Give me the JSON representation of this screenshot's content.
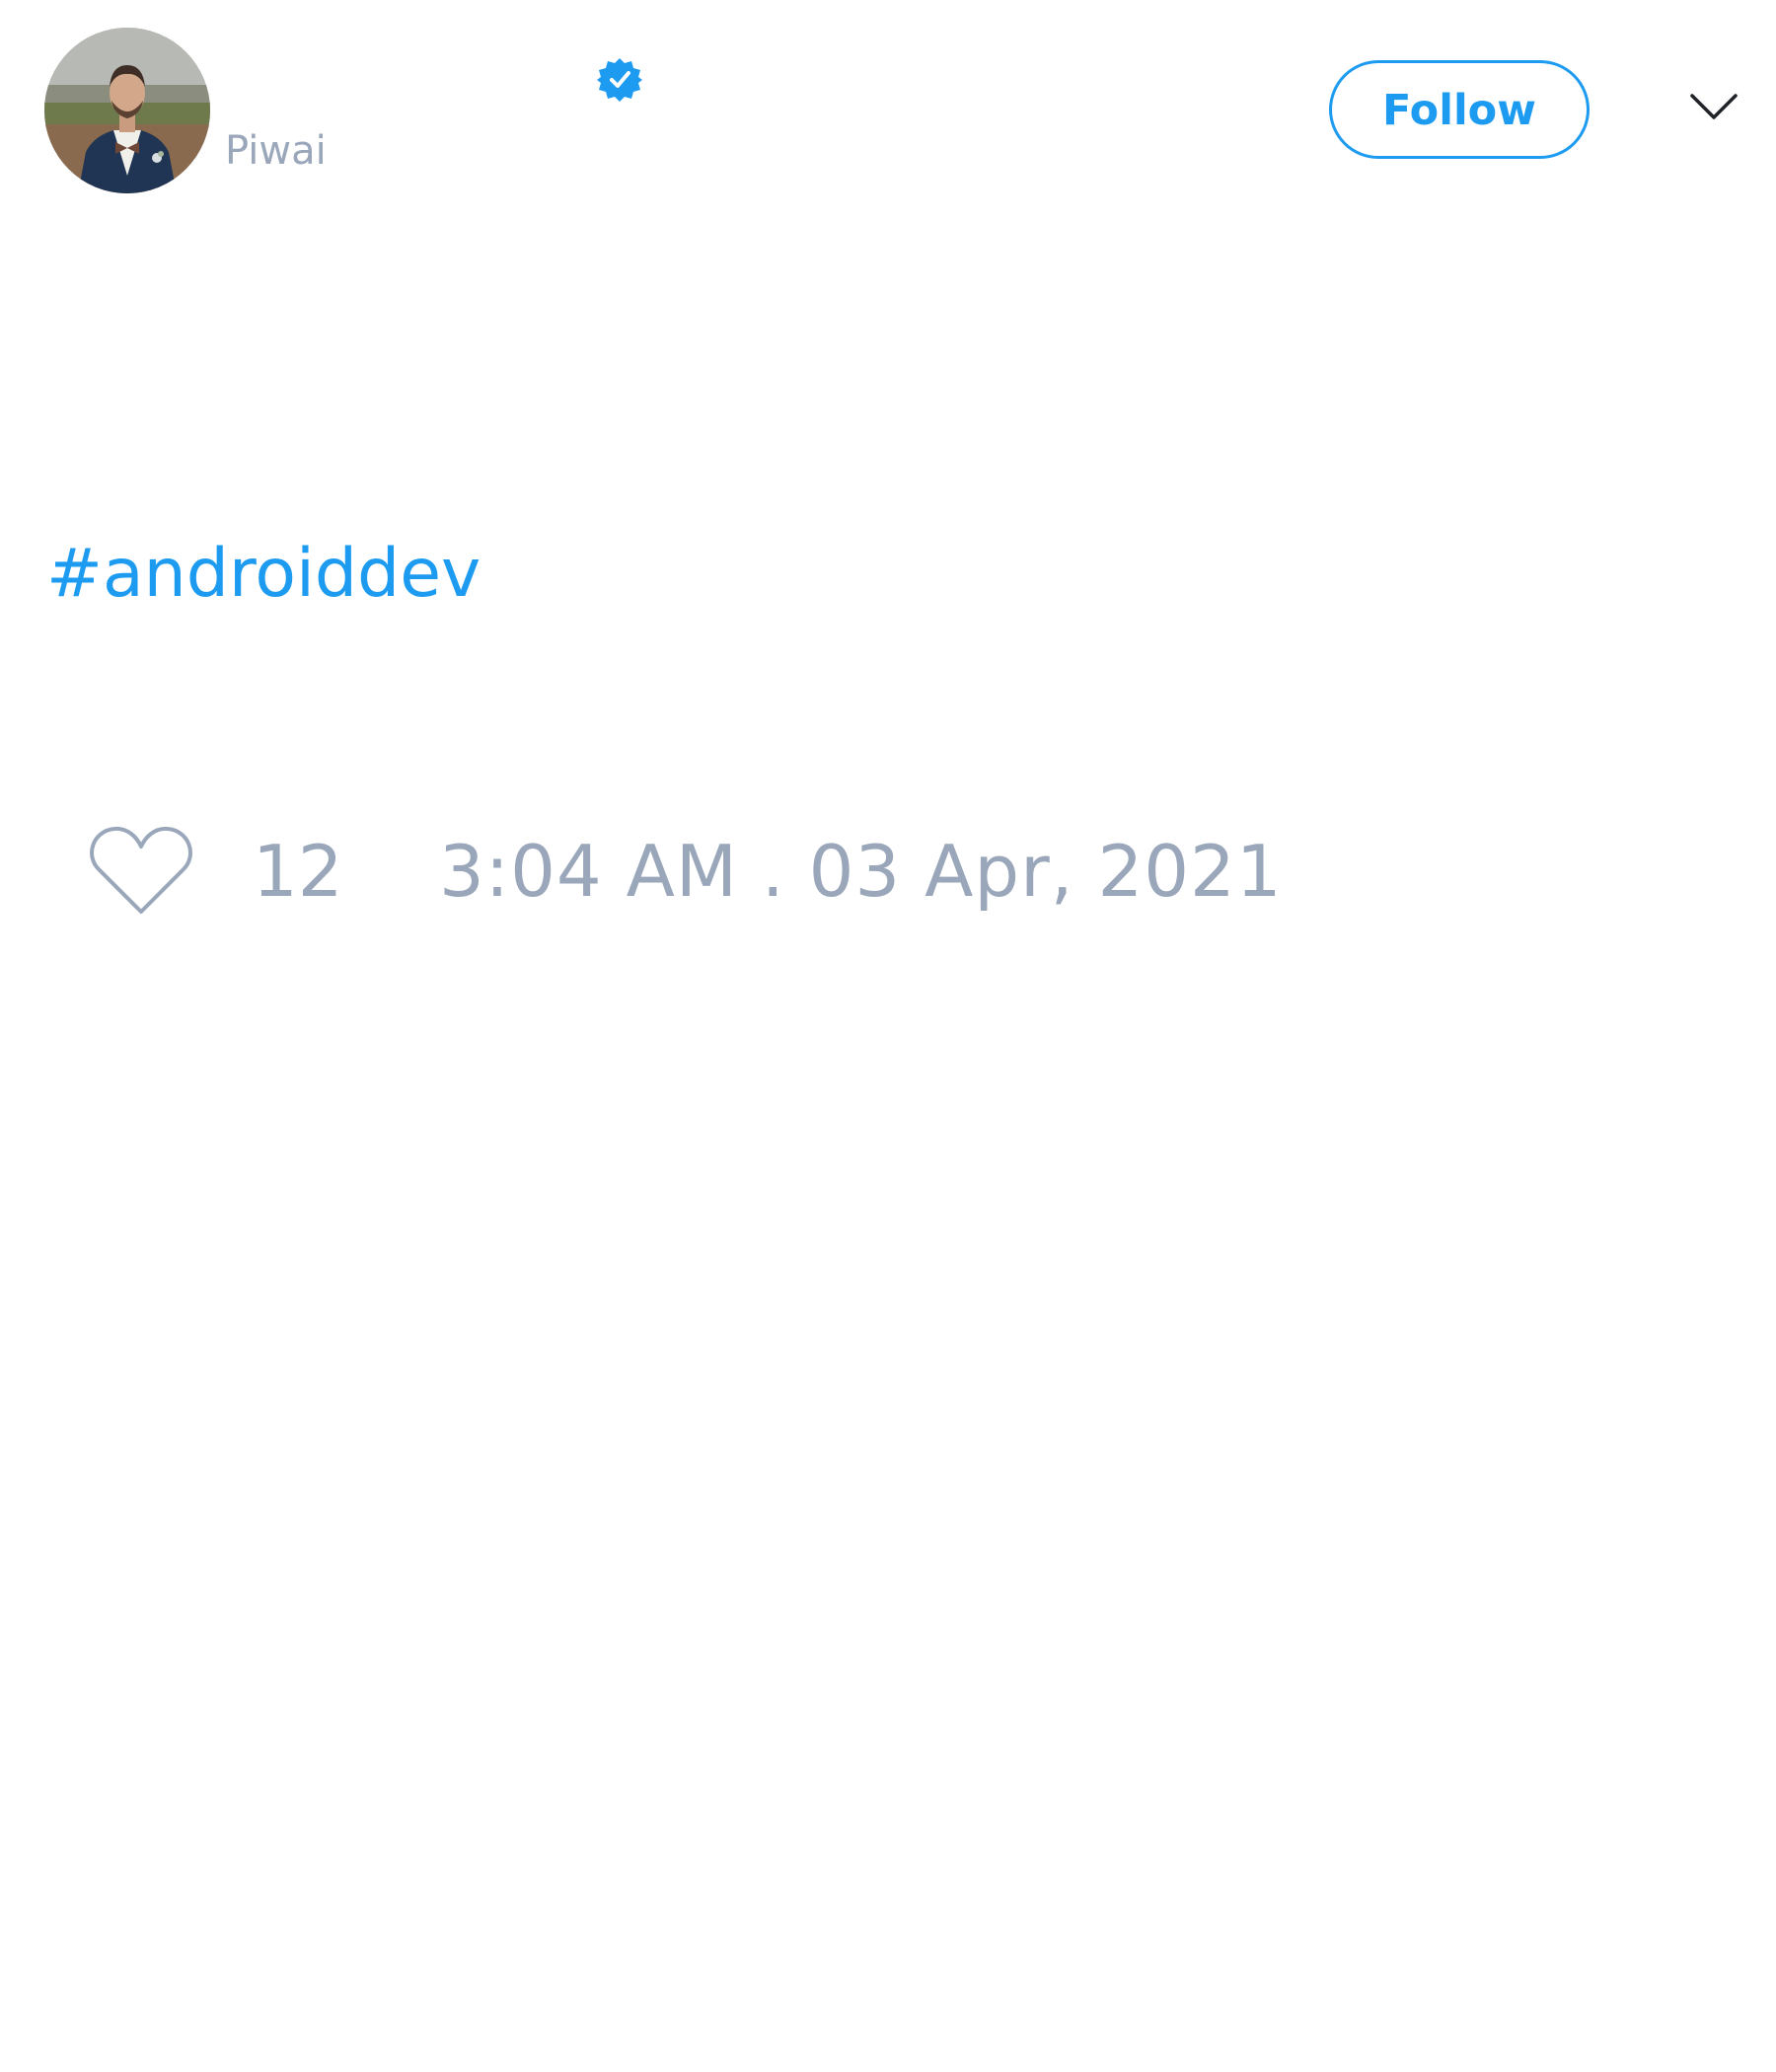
{
  "author": {
    "handle": "Piwai",
    "verified": true,
    "avatar": "profile-photo-man-in-navy-suit-bow-tie"
  },
  "actions": {
    "follow_label": "Follow",
    "menu_icon": "chevron-down-icon"
  },
  "tweet": {
    "hashtag": "#androiddev",
    "like_count": "12",
    "timestamp": "3:04 AM . 03 Apr, 2021"
  },
  "icons": {
    "verified": "verified-badge-icon",
    "like": "heart-icon"
  },
  "colors": {
    "accent": "#1d9bf0",
    "muted_text": "#9aa7ba",
    "background": "#ffffff"
  }
}
